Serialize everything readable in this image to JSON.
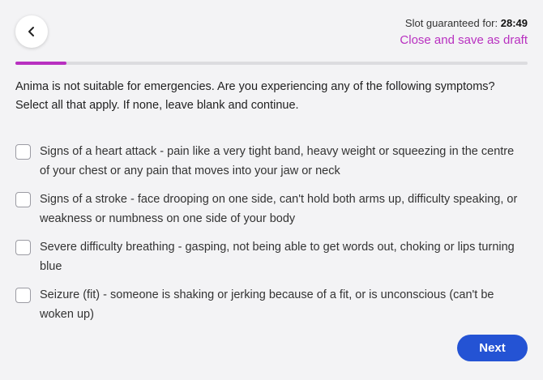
{
  "header": {
    "back_icon": "chevron-left-icon",
    "timer_label": "Slot guaranteed for:",
    "timer_value": "28:49",
    "save_draft_label": "Close and save as draft"
  },
  "progress": {
    "fraction": 0.1,
    "color": "#b830c0"
  },
  "question": {
    "line1": "Anima is not suitable for emergencies. Are you experiencing any of the following symptoms?",
    "line2": "Select all that apply. If none, leave blank and continue."
  },
  "options": [
    {
      "label": "Signs of a heart attack - pain like a very tight band, heavy weight or squeezing in the centre of your chest or any pain that moves into your jaw or neck",
      "checked": false
    },
    {
      "label": "Signs of a stroke - face drooping on one side, can't hold both arms up, difficulty speaking, or weakness or numbness on one side of your body",
      "checked": false
    },
    {
      "label": "Severe difficulty breathing - gasping, not being able to get words out, choking or lips turning blue",
      "checked": false
    },
    {
      "label": "Seizure (fit) - someone is shaking or jerking because of a fit, or is unconscious (can't be woken up)",
      "checked": false
    }
  ],
  "footer": {
    "next_label": "Next"
  },
  "colors": {
    "accent": "#b830c0",
    "primary_button": "#2453d4",
    "background": "#f3f3f5"
  }
}
